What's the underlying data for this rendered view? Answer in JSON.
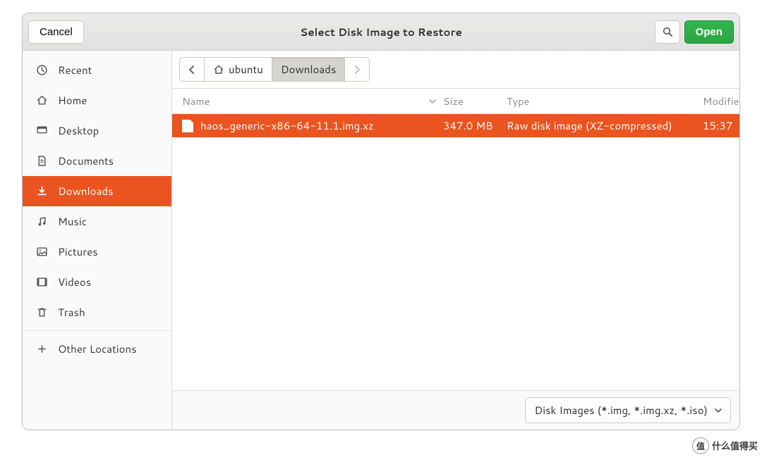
{
  "header": {
    "title": "Select Disk Image to Restore",
    "cancel_label": "Cancel",
    "open_label": "Open"
  },
  "sidebar": {
    "items": [
      {
        "label": "Recent"
      },
      {
        "label": "Home"
      },
      {
        "label": "Desktop"
      },
      {
        "label": "Documents"
      },
      {
        "label": "Downloads"
      },
      {
        "label": "Music"
      },
      {
        "label": "Pictures"
      },
      {
        "label": "Videos"
      },
      {
        "label": "Trash"
      }
    ],
    "other_label": "Other Locations"
  },
  "path": {
    "parent": "ubuntu",
    "current": "Downloads"
  },
  "columns": {
    "name": "Name",
    "size": "Size",
    "type": "Type",
    "modified": "Modified"
  },
  "files": [
    {
      "name": "haos_generic-x86-64-11.1.img.xz",
      "size": "347.0 MB",
      "type": "Raw disk image (XZ-compressed)",
      "modified": "15:37"
    }
  ],
  "filter": {
    "label": "Disk Images (*.img, *.img.xz, *.iso)"
  },
  "watermark": {
    "badge": "值",
    "text": "什么值得买"
  }
}
